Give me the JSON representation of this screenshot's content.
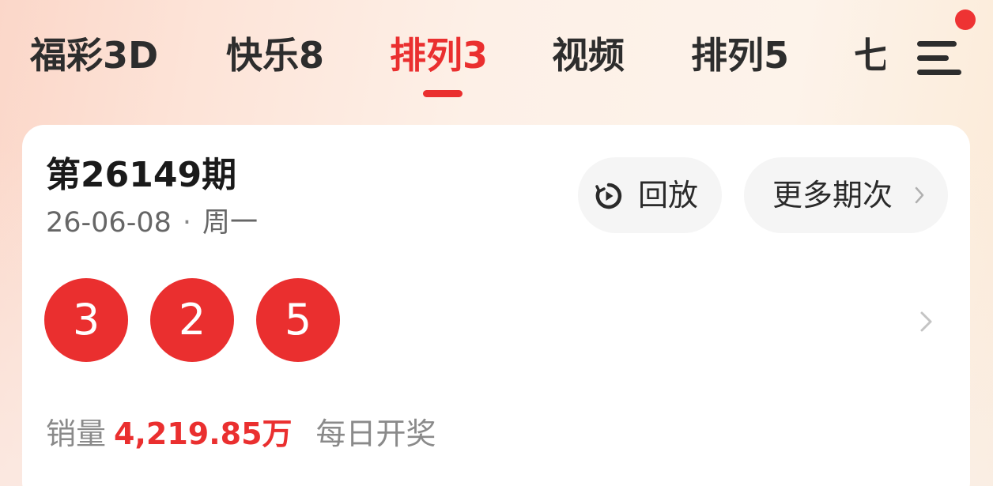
{
  "tabs": [
    {
      "label": "福彩3D",
      "active": false
    },
    {
      "label": "快乐8",
      "active": false
    },
    {
      "label": "排列3",
      "active": true
    },
    {
      "label": "视频",
      "active": false
    },
    {
      "label": "排列5",
      "active": false
    },
    {
      "label": "七",
      "active": false
    }
  ],
  "menu": {
    "icon": "menu-icon",
    "badge": "notification-dot"
  },
  "draw": {
    "issue": "第26149期",
    "date": "26-06-08",
    "separator": "·",
    "weekday": "周一",
    "replay_label": "回放",
    "replay_icon": "replay-clock-icon",
    "more_label": "更多期次",
    "numbers": [
      "3",
      "2",
      "5"
    ],
    "sales_label": "销量",
    "sales_value": "4,219.85万",
    "frequency": "每日开奖"
  },
  "colors": {
    "accent": "#ea2f2f",
    "text_primary": "#2d2d2d",
    "text_secondary": "#8a8a8a",
    "pill_background": "#f5f5f5"
  }
}
